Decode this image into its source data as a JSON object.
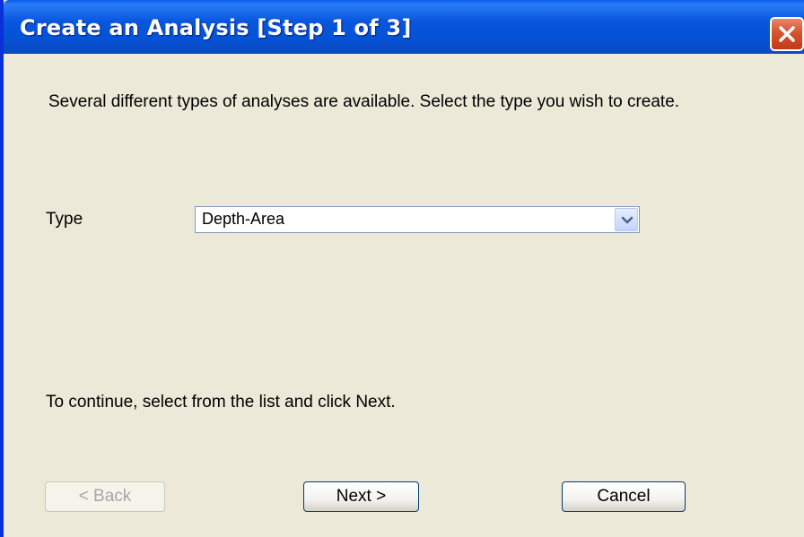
{
  "window": {
    "title": "Create an Analysis [Step 1 of 3]",
    "close_icon": "close-icon"
  },
  "intro_text": "Several different types of analyses are available. Select the type you wish to create.",
  "type_field": {
    "label": "Type",
    "value": "Depth-Area",
    "arrow_icon": "chevron-down-icon"
  },
  "continue_text": "To continue, select from the list and click Next.",
  "buttons": {
    "back": "< Back",
    "next": "Next >",
    "cancel": "Cancel"
  },
  "colors": {
    "titlebar": "#0452d6",
    "dialog_background": "#ece9d8",
    "close_button": "#d6532f"
  }
}
